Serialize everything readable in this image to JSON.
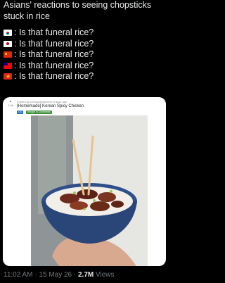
{
  "tweet": {
    "headline_1": "Asians' reactions to seeing chopsticks",
    "headline_2": "stuck in rice",
    "lines": [
      {
        "flag": "kr-flag-icon",
        "text": ": Is that funeral rice?"
      },
      {
        "flag": "jp-flag-icon",
        "text": ": Is that funeral rice?"
      },
      {
        "flag": "cn-flag-icon",
        "text": ": Is that funeral rice?"
      },
      {
        "flag": "tw-flag-icon",
        "text": ": Is that funeral rice?"
      },
      {
        "flag": "vn-flag-icon",
        "text": ": Is that funeral rice?"
      }
    ]
  },
  "media": {
    "votes": "2.9k",
    "posted_by": "Posted by u/chopsticksinrice 8 days ago",
    "title": "[Homemade] Korean Spicy Chicken",
    "flair_1": "OC",
    "flair_2": "Recipe In Comments"
  },
  "footer": {
    "time": "11:02 AM",
    "sep1": " · ",
    "date": "15 May 26",
    "sep2": " · ",
    "views_count": "2.7M",
    "views_label": " Views"
  }
}
